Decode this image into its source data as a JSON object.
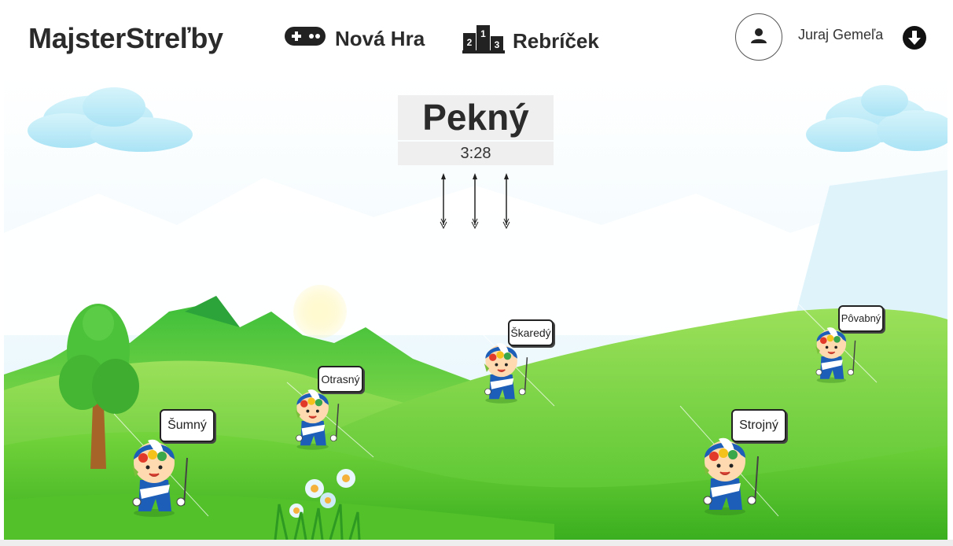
{
  "header": {
    "brand": "MajsterStreľby",
    "nav": {
      "new_game": "Nová Hra",
      "leaderboard": "Rebríček"
    },
    "user": {
      "name": "Juraj Gemeľa"
    }
  },
  "game": {
    "target_word": "Pekný",
    "timer": "3:28",
    "arrows_remaining": 3,
    "targets": [
      {
        "label": "Šumný"
      },
      {
        "label": "Otrasný"
      },
      {
        "label": "Škaredý"
      },
      {
        "label": "Pôvabný"
      },
      {
        "label": "Strojný"
      }
    ]
  },
  "colors": {
    "sky": "#dff3fb",
    "grass": "#6fd13a",
    "mascot_blue": "#1d5fb8"
  },
  "icons": {
    "new_game": "gamepad-icon",
    "leaderboard": "podium-icon",
    "user": "user-icon",
    "menu": "arrow-down-circle-icon"
  }
}
